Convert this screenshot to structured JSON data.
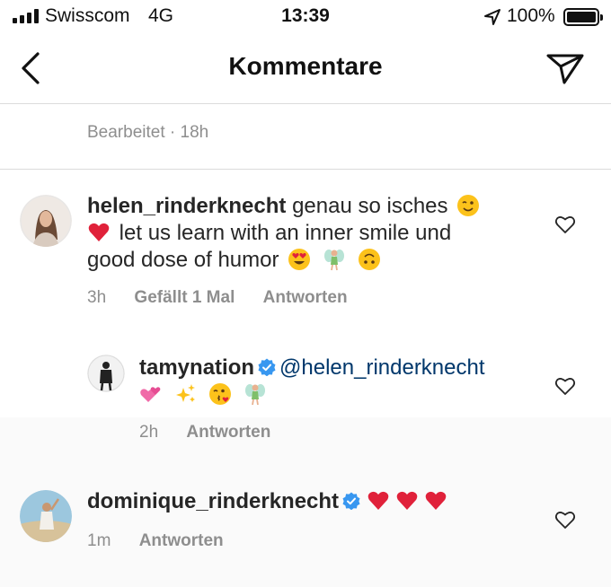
{
  "status_bar": {
    "carrier": "Swisscom",
    "network": "4G",
    "time": "13:39",
    "battery": "100%"
  },
  "header": {
    "title": "Kommentare"
  },
  "caption": {
    "edited": "Bearbeitet · 18h"
  },
  "comments": [
    {
      "username": "helen_rinderknecht",
      "text_1": "genau so isches",
      "text_2": "let us learn with an inner smile und",
      "text_3": "good dose of humor",
      "time": "3h",
      "likes": "Gefällt 1 Mal",
      "reply": "Antworten"
    },
    {
      "username": "tamynation",
      "mention": "@helen_rinderknecht",
      "time": "2h",
      "reply": "Antworten"
    },
    {
      "username": "dominique_rinderknecht",
      "time": "1m",
      "reply": "Antworten"
    }
  ],
  "colors": {
    "verified": "#3897f0",
    "mention": "#00376b",
    "muted": "#8e8e8e",
    "heart_red": "#e0213a"
  }
}
